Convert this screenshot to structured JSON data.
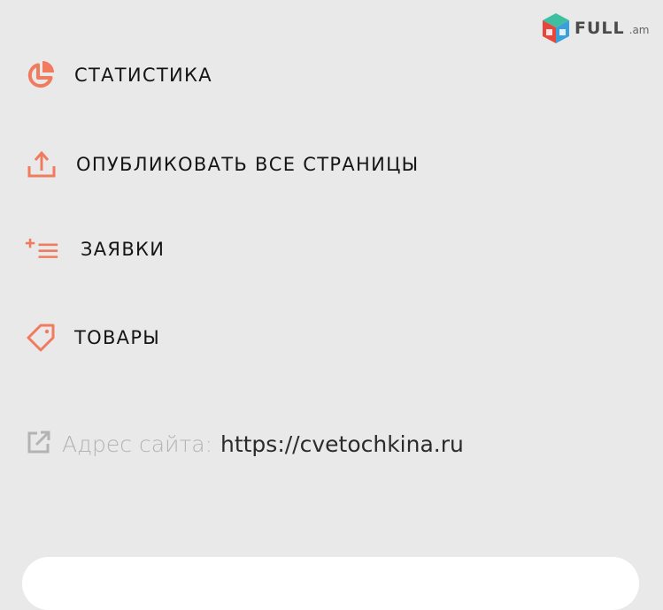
{
  "watermark": {
    "brand": "FULL",
    "domain": ".am"
  },
  "menu": {
    "items": [
      {
        "label": "СТАТИСТИКА",
        "icon": "pie-chart-icon"
      },
      {
        "label": "ОПУБЛИКОВАТЬ ВСЕ СТРАНИЦЫ",
        "icon": "upload-icon"
      },
      {
        "label": "ЗАЯВКИ",
        "icon": "add-list-icon"
      },
      {
        "label": "ТОВАРЫ",
        "icon": "tag-icon"
      }
    ]
  },
  "site": {
    "address_label": "Адрес сайта:",
    "url": "https://cvetochkina.ru"
  },
  "colors": {
    "accent": "#f07b5f",
    "background": "#e9e9e9",
    "muted": "#b3b3b3",
    "text": "#151515"
  }
}
